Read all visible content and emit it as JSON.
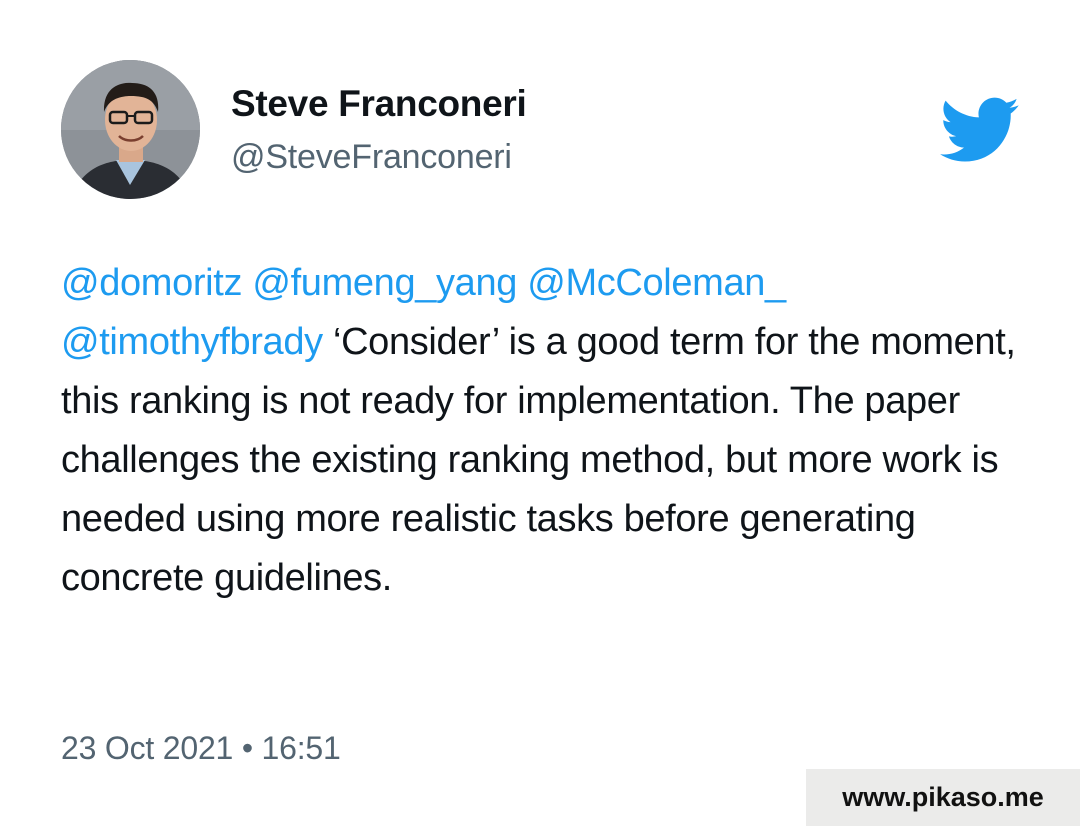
{
  "author": {
    "display_name": "Steve Franconeri",
    "handle": "@SteveFranconeri"
  },
  "tweet": {
    "mentions": [
      "@domoritz",
      "@fumeng_yang",
      "@McColeman_",
      "@timothyfbrady"
    ],
    "body": "‘Consider’ is a good term for the moment, this ranking is not ready for implementation. The paper challenges the existing ranking method, but more work is needed using more realistic tasks before generating concrete guidelines.",
    "timestamp": "23 Oct 2021 • 16:51"
  },
  "watermark": "www.pikaso.me",
  "icons": {
    "brand": "twitter-bird-icon"
  },
  "colors": {
    "mention": "#1d9bf0",
    "bird": "#1d9bf0",
    "secondary_text": "#536471",
    "primary_text": "#0f1419"
  }
}
